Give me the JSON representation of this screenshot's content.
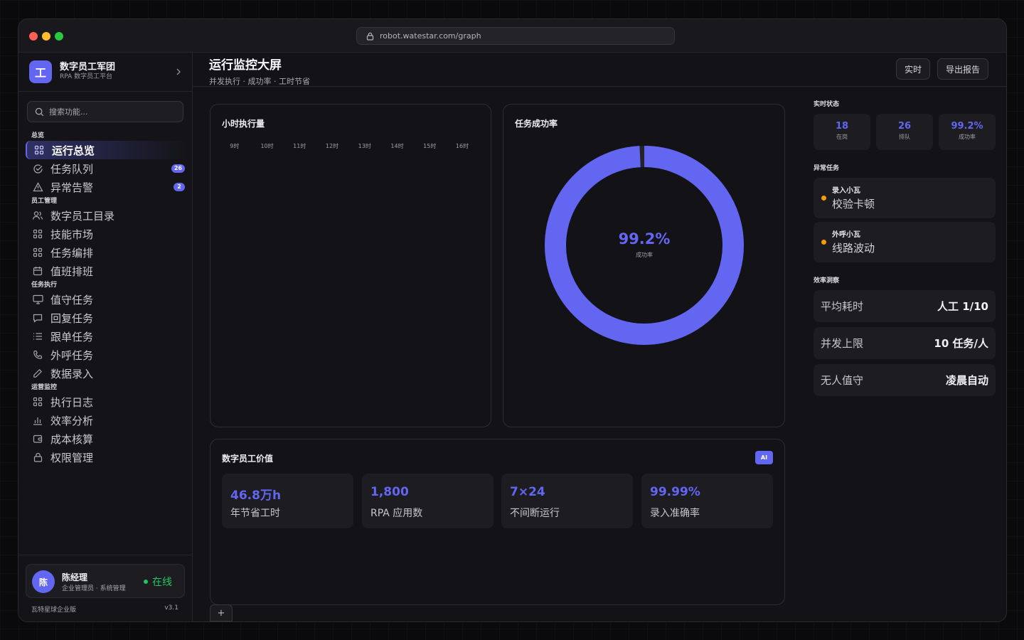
{
  "browser": {
    "url": "robot.watestar.com/graph"
  },
  "brand": {
    "title": "数字员工军团",
    "subtitle": "RPA 数字员工平台",
    "logo_letter": "工"
  },
  "search": {
    "placeholder": "搜索功能..."
  },
  "nav": {
    "sections": [
      {
        "title": "总览",
        "items": [
          {
            "label": "运行总览",
            "icon": "grid-icon",
            "active": true
          },
          {
            "label": "任务队列",
            "icon": "check-circle-icon",
            "badge": "26"
          },
          {
            "label": "异常告警",
            "icon": "warning-icon",
            "badge": "2"
          }
        ]
      },
      {
        "title": "员工管理",
        "items": [
          {
            "label": "数字员工目录",
            "icon": "users-icon"
          },
          {
            "label": "技能市场",
            "icon": "grid-icon"
          },
          {
            "label": "任务编排",
            "icon": "grid-icon"
          },
          {
            "label": "值班排班",
            "icon": "calendar-icon"
          }
        ]
      },
      {
        "title": "任务执行",
        "items": [
          {
            "label": "值守任务",
            "icon": "monitor-icon"
          },
          {
            "label": "回复任务",
            "icon": "chat-icon"
          },
          {
            "label": "跟单任务",
            "icon": "list-icon"
          },
          {
            "label": "外呼任务",
            "icon": "phone-icon"
          },
          {
            "label": "数据录入",
            "icon": "pen-icon"
          }
        ]
      },
      {
        "title": "运营监控",
        "items": [
          {
            "label": "执行日志",
            "icon": "grid-icon"
          },
          {
            "label": "效率分析",
            "icon": "bar-chart-icon"
          },
          {
            "label": "成本核算",
            "icon": "wallet-icon"
          },
          {
            "label": "权限管理",
            "icon": "lock-icon"
          }
        ]
      }
    ]
  },
  "user": {
    "avatar": "陈",
    "name": "陈经理",
    "role": "企业管理员 · 系统管理",
    "status": "在线"
  },
  "footer": {
    "edition": "瓦特星球企业版",
    "version": "v3.1"
  },
  "header": {
    "title": "运行监控大屏",
    "subtitle": "并发执行 · 成功率 · 工时节省",
    "buttons": [
      "实时",
      "导出报告"
    ]
  },
  "hourly_card": {
    "title": "小时执行量",
    "hours": [
      "9时",
      "10时",
      "11时",
      "12时",
      "13时",
      "14时",
      "15时",
      "16时"
    ]
  },
  "success_card": {
    "title": "任务成功率",
    "value": "99.2%",
    "label": "成功率",
    "percent": 99.2,
    "color": "#6366f1"
  },
  "value_card": {
    "title": "数字员工价值",
    "badge": "AI",
    "stats": [
      {
        "value": "46.8万h",
        "label": "年节省工时"
      },
      {
        "value": "1,800",
        "label": "RPA 应用数"
      },
      {
        "value": "7×24",
        "label": "不间断运行"
      },
      {
        "value": "99.99%",
        "label": "录入准确率"
      }
    ]
  },
  "right_panel": {
    "realtime_title": "实时状态",
    "realtime": [
      {
        "value": "18",
        "label": "在岗"
      },
      {
        "value": "26",
        "label": "排队"
      },
      {
        "value": "99.2%",
        "label": "成功率"
      }
    ],
    "alerts_title": "异常任务",
    "alerts": [
      {
        "who": "录入小瓦",
        "what": "校验卡顿"
      },
      {
        "who": "外呼小瓦",
        "what": "线路波动"
      }
    ],
    "efficiency_title": "效率洞察",
    "efficiency": [
      {
        "key": "平均耗时",
        "value": "人工 1/10"
      },
      {
        "key": "并发上限",
        "value": "10 任务/人"
      },
      {
        "key": "无人值守",
        "value": "凌晨自动"
      }
    ]
  },
  "add_tab": {
    "label": "+"
  },
  "colors": {
    "accent": "#6366f1",
    "success": "#22c55e",
    "warning": "#f59e0b"
  }
}
